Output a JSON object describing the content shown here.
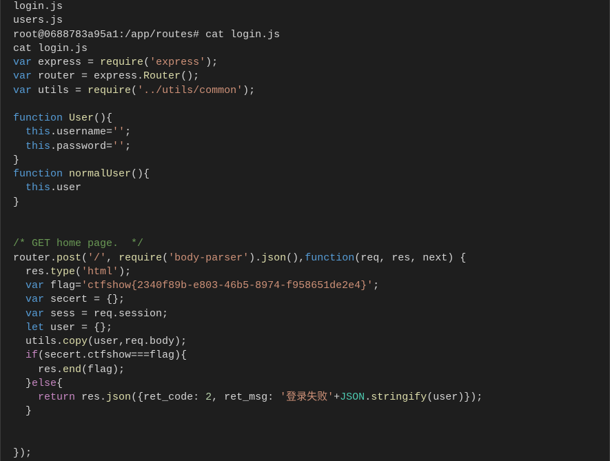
{
  "terminal": {
    "ls_output_1": "login.js",
    "ls_output_2": "users.js",
    "prompt_user": "root@0688783a95a1",
    "prompt_path": ":/app/routes# ",
    "command": "cat login.js",
    "echo_command": "cat login.js"
  },
  "code": {
    "kw_var": "var",
    "kw_function": "function",
    "kw_this": "this",
    "kw_let": "let",
    "kw_if": "if",
    "kw_else": "else",
    "kw_return": "return",
    "line1_a": " express = ",
    "line1_require": "require",
    "line1_b": "(",
    "line1_str": "'express'",
    "line1_c": ");",
    "line2_a": " router = express.",
    "line2_router": "Router",
    "line2_b": "();",
    "line3_a": " utils = ",
    "line3_require": "require",
    "line3_b": "(",
    "line3_str": "'../utils/common'",
    "line3_c": ");",
    "fn_user": "User",
    "fn_user_open": "(){",
    "user_body1_a": ".username=",
    "user_body1_str": "''",
    "user_body1_b": ";",
    "user_body2_a": ".password=",
    "user_body2_str": "''",
    "user_body2_b": ";",
    "close_brace": "}",
    "fn_normal": "normalUser",
    "fn_normal_open": "(){",
    "normal_body_a": ".user",
    "comment_home": "/* GET home page.  */",
    "post_a": "router.",
    "post_fn": "post",
    "post_b": "(",
    "post_str1": "'/'",
    "post_c": ", ",
    "post_require": "require",
    "post_d": "(",
    "post_str2": "'body-parser'",
    "post_e": ").",
    "post_json": "json",
    "post_f": "(),",
    "post_g": "(req, res, next) {",
    "body1_a": "  res.",
    "body1_type": "type",
    "body1_b": "(",
    "body1_str": "'html'",
    "body1_c": ");",
    "body2_a": " flag=",
    "body2_str": "'ctfshow{2340f89b-e803-46b5-8974-f958651de2e4}'",
    "body2_b": ";",
    "body3_a": " secert = {};",
    "body4_a": " sess = req.session;",
    "body5_a": " user = {};",
    "body6_a": "  utils.",
    "body6_copy": "copy",
    "body6_b": "(user,req.body);",
    "body7_a": "(secert.ctfshow===flag){",
    "body8_a": "    res.",
    "body8_end": "end",
    "body8_b": "(flag);",
    "body9_a": "  }",
    "body9_b": "{",
    "body10_a": " res.",
    "body10_json": "json",
    "body10_b": "({ret_code: ",
    "body10_num": "2",
    "body10_c": ", ret_msg: ",
    "body10_str": "'登录失败'",
    "body10_d": "+",
    "body10_json2": "JSON",
    "body10_e": ".",
    "body10_stringify": "stringify",
    "body10_f": "(user)});",
    "body11_a": "  }",
    "close_router": "});"
  }
}
